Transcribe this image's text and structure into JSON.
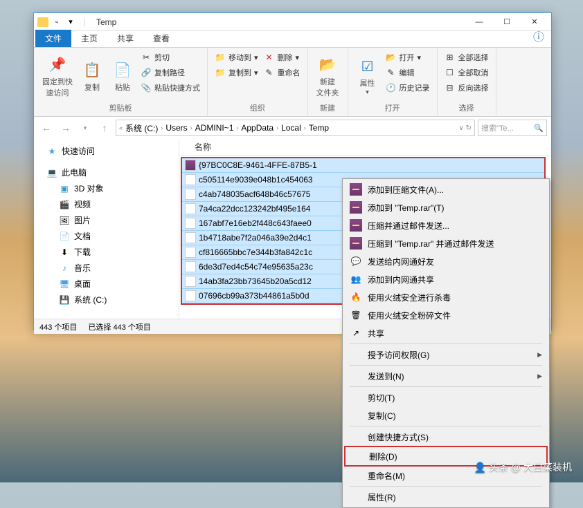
{
  "titlebar": {
    "title": "Temp"
  },
  "win_controls": {
    "min": "—",
    "max": "☐",
    "close": "✕"
  },
  "tabs": {
    "file": "文件",
    "home": "主页",
    "share": "共享",
    "view": "查看"
  },
  "ribbon": {
    "pin": "固定到快\n速访问",
    "copy": "复制",
    "paste": "粘贴",
    "cut": "剪切",
    "copy_path": "复制路径",
    "paste_shortcut": "粘贴快捷方式",
    "clipboard": "剪贴板",
    "move_to": "移动到",
    "copy_to": "复制到",
    "delete": "删除",
    "rename": "重命名",
    "organize": "组织",
    "new_folder": "新建\n文件夹",
    "new": "新建",
    "properties": "属性",
    "open_btn": "打开",
    "edit": "编辑",
    "history": "历史记录",
    "open": "打开",
    "select_all": "全部选择",
    "select_none": "全部取消",
    "invert": "反向选择",
    "select": "选择"
  },
  "breadcrumb": {
    "items": [
      "系统 (C:)",
      "Users",
      "ADMINI~1",
      "AppData",
      "Local",
      "Temp"
    ]
  },
  "search": {
    "placeholder": "搜索\"Te..."
  },
  "nav": {
    "quick": "快速访问",
    "pc": "此电脑",
    "objects3d": "3D 对象",
    "videos": "视频",
    "pictures": "图片",
    "documents": "文档",
    "downloads": "下载",
    "music": "音乐",
    "desktop": "桌面",
    "system_c": "系统 (C:)"
  },
  "file_header": {
    "name": "名称"
  },
  "files": [
    {
      "icon": "rar",
      "name": "{97BC0C8E-9461-4FFE-87B5-1"
    },
    {
      "icon": "txt",
      "name": "c505114e9039e048b1c454063"
    },
    {
      "icon": "txt",
      "name": "c4ab748035acf648b46c57675"
    },
    {
      "icon": "txt",
      "name": "7a4ca22dcc123242bf495e164"
    },
    {
      "icon": "txt",
      "name": "167abf7e16eb2f448c643faee0"
    },
    {
      "icon": "txt",
      "name": "1b4718abe7f2a046a39e2d4c1"
    },
    {
      "icon": "txt",
      "name": "cf816665bbc7e344b3fa842c1c"
    },
    {
      "icon": "txt",
      "name": "6de3d7ed4c54c74e95635a23c"
    },
    {
      "icon": "txt",
      "name": "14ab3fa23bb73645b20a5cd12"
    },
    {
      "icon": "txt",
      "name": "07696cb99a373b44861a5b0d"
    }
  ],
  "status": {
    "count": "443 个项目",
    "selected": "已选择 443 个项目"
  },
  "context": {
    "add_archive": "添加到压缩文件(A)...",
    "add_temp_rar": "添加到 \"Temp.rar\"(T)",
    "compress_email": "压缩并通过邮件发送...",
    "compress_temp_email": "压缩到 \"Temp.rar\" 并通过邮件发送",
    "send_friend": "发送给内网通好友",
    "add_share": "添加到内网通共享",
    "huorong_scan": "使用火绒安全进行杀毒",
    "huorong_shred": "使用火绒安全粉碎文件",
    "share": "共享",
    "grant_access": "授予访问权限(G)",
    "send_to": "发送到(N)",
    "cut": "剪切(T)",
    "copy": "复制(C)",
    "create_shortcut": "创建快捷方式(S)",
    "delete": "删除(D)",
    "rename": "重命名(M)",
    "properties": "属性(R)"
  },
  "watermark": {
    "text": "头条 @ 大白菜装机"
  }
}
